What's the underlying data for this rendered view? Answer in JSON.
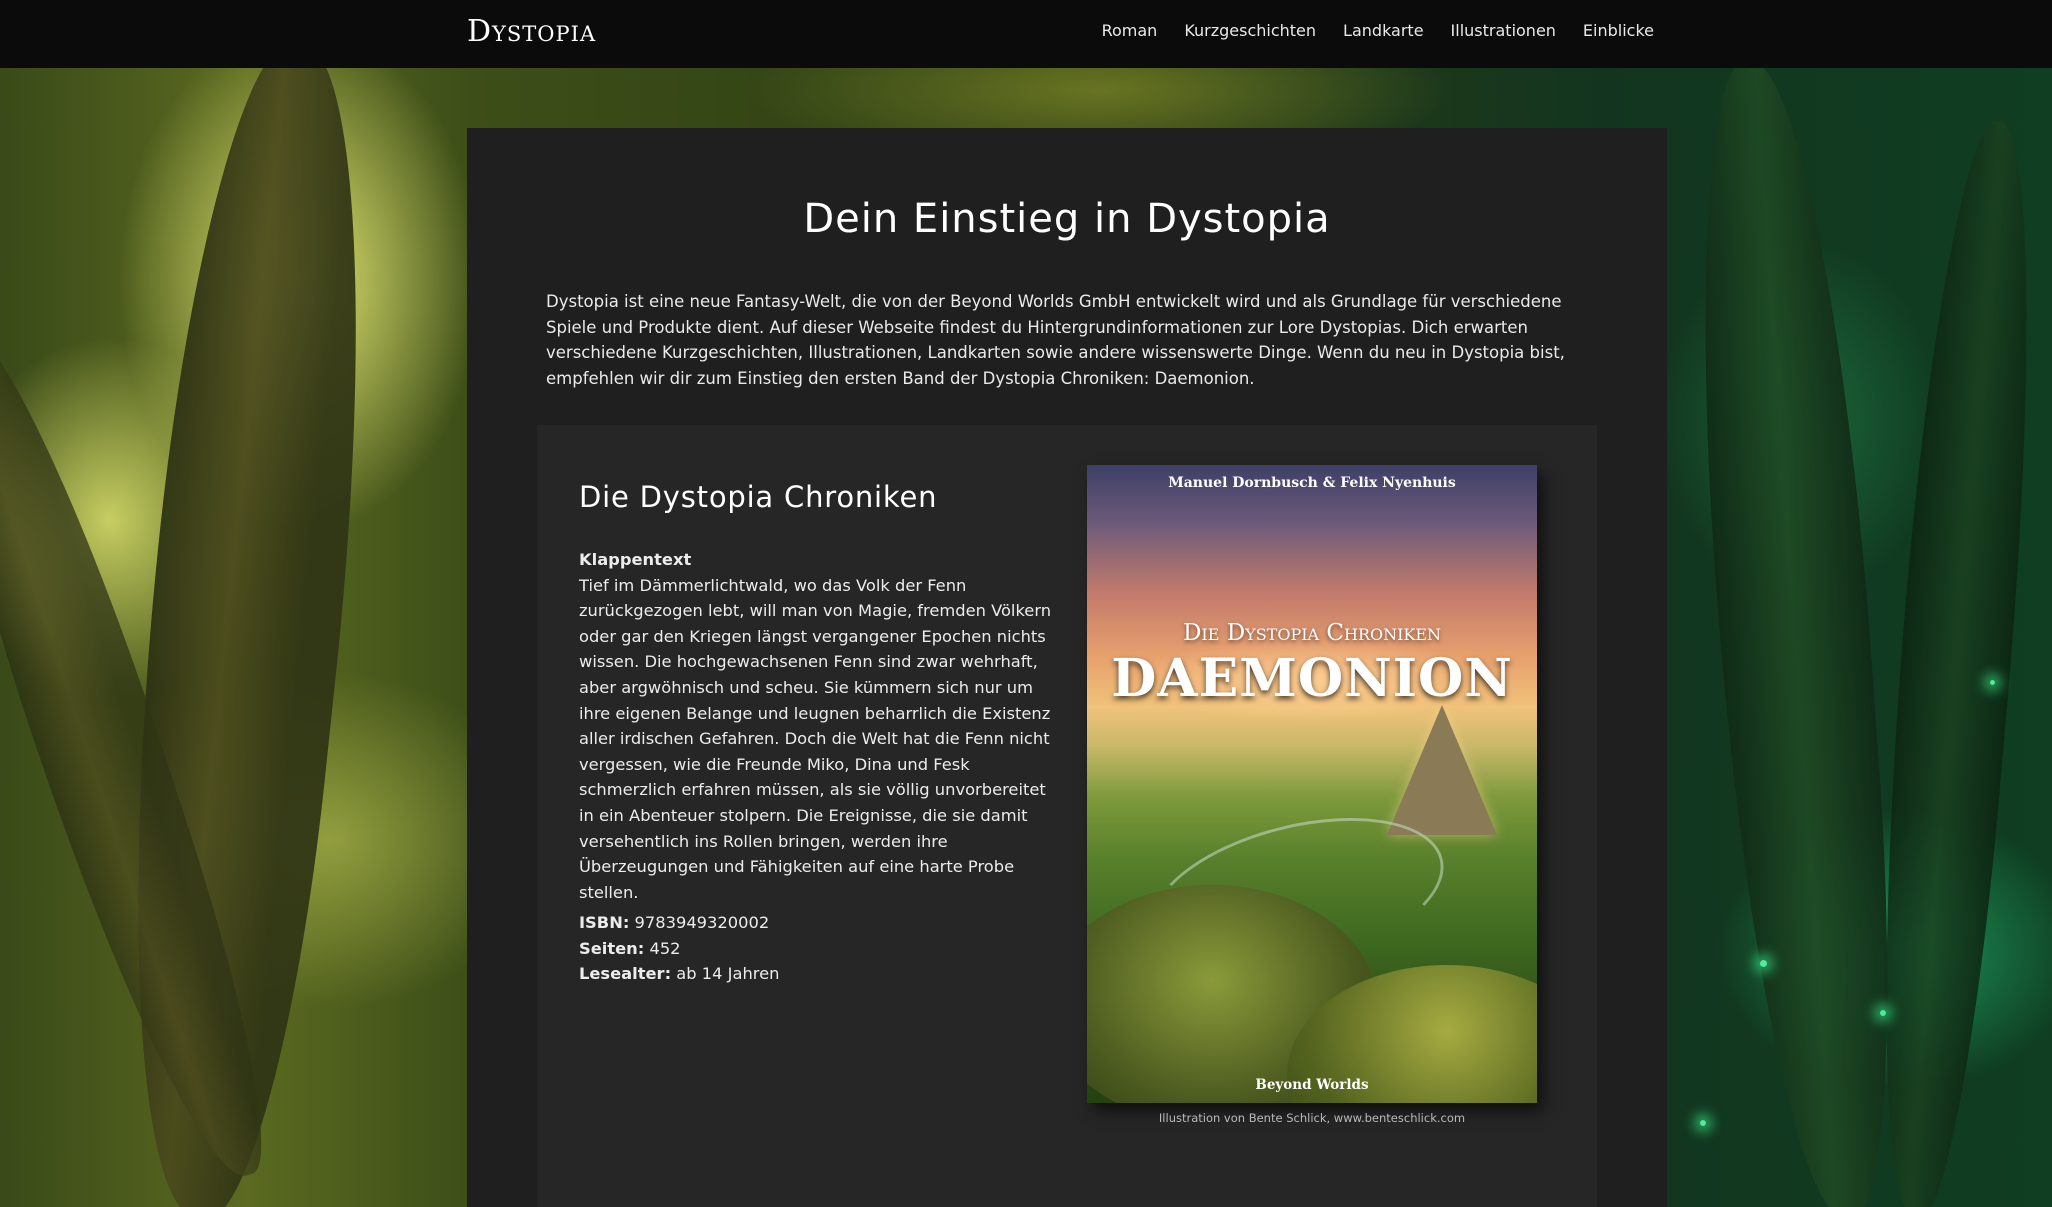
{
  "header": {
    "logo": "Dystopia",
    "nav": [
      "Roman",
      "Kurzgeschichten",
      "Landkarte",
      "Illustrationen",
      "Einblicke"
    ]
  },
  "main": {
    "title": "Dein Einstieg in Dystopia",
    "intro": "Dystopia ist eine neue Fantasy-Welt, die von der Beyond Worlds GmbH entwickelt wird und als Grundlage für verschiedene Spiele und Produkte dient. Auf dieser Webseite findest du Hintergrundinformationen zur Lore Dystopias. Dich erwarten verschiedene Kurzgeschichten, Illustrationen, Landkarten sowie andere wissenswerte Dinge. Wenn du neu in Dystopia bist, empfehlen wir dir zum Einstieg den ersten Band der Dystopia Chroniken: Daemonion."
  },
  "book": {
    "title": "Die Dystopia Chroniken",
    "blurb_heading": "Klappentext",
    "blurb": "Tief im Dämmerlichtwald, wo das Volk der Fenn zurückgezogen lebt, will man von Magie, fremden Völkern oder gar den Kriegen längst vergangener Epochen nichts wissen. Die hochgewachsenen Fenn sind zwar wehrhaft, aber argwöhnisch und scheu. Sie kümmern sich nur um ihre eigenen Belange und leugnen beharrlich die Existenz aller irdischen Gefahren. Doch die Welt hat die Fenn nicht vergessen, wie die Freunde Miko, Dina und Fesk schmerzlich erfahren müssen, als sie völlig unvorbereitet in ein Abenteuer stolpern. Die Ereignisse, die sie damit versehentlich ins Rollen bringen, werden ihre Überzeugungen und Fähigkeiten auf eine harte Probe stellen.",
    "isbn_label": "ISBN:",
    "isbn": "9783949320002",
    "pages_label": "Seiten:",
    "pages": "452",
    "age_label": "Lesealter:",
    "age": "ab 14 Jahren",
    "cover": {
      "authors": "Manuel Dornbusch & Felix Nyenhuis",
      "series": "Die Dystopia Chroniken",
      "title": "DAEMONION",
      "publisher": "Beyond Worlds"
    },
    "caption": "Illustration von Bente Schlick, www.benteschlick.com"
  }
}
